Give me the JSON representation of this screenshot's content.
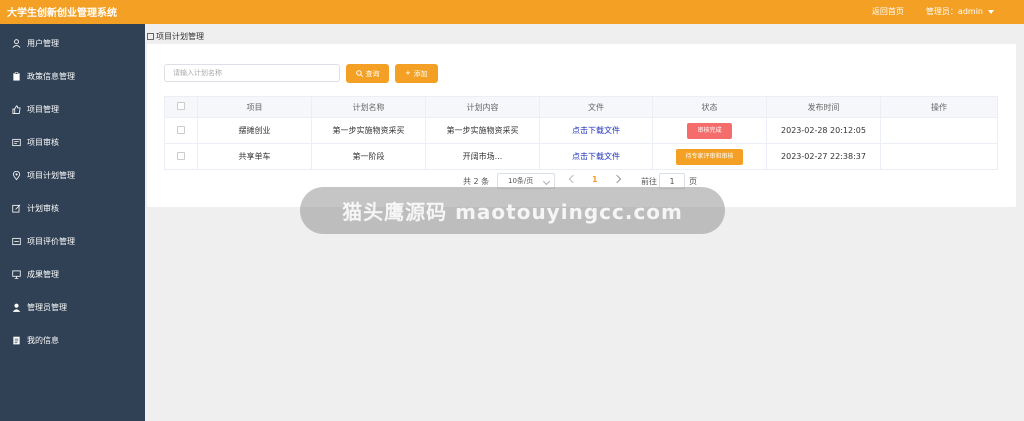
{
  "header": {
    "app_title": "大学生创新创业管理系统",
    "home_link": "返回首页",
    "admin_label": "管理员：admin"
  },
  "sidebar": {
    "items": [
      {
        "label": "用户管理",
        "icon": "user-icon"
      },
      {
        "label": "政策信息管理",
        "icon": "clipboard-icon"
      },
      {
        "label": "项目管理",
        "icon": "thumbs-up-icon"
      },
      {
        "label": "项目审核",
        "icon": "document-icon"
      },
      {
        "label": "项目计划管理",
        "icon": "location-icon"
      },
      {
        "label": "计划审核",
        "icon": "edit-icon"
      },
      {
        "label": "项目评价管理",
        "icon": "edit-box-icon"
      },
      {
        "label": "成果管理",
        "icon": "monitor-icon"
      },
      {
        "label": "管理员管理",
        "icon": "person-icon"
      },
      {
        "label": "我的信息",
        "icon": "file-icon"
      }
    ]
  },
  "breadcrumb": "项目计划管理",
  "search": {
    "placeholder": "请输入计划名称",
    "query_label": "查询",
    "add_label": "添加"
  },
  "table": {
    "headers": [
      "",
      "项目",
      "计划名称",
      "计划内容",
      "文件",
      "状态",
      "发布时间",
      "操作"
    ],
    "rows": [
      {
        "project": "摆摊创业",
        "plan_name": "第一步实施物资采买",
        "content": "第一步实施物资采买",
        "file": "点击下载文件",
        "status": "审核完成",
        "time": "2023-02-28 20:12:05"
      },
      {
        "project": "共享单车",
        "plan_name": "第一阶段",
        "content": "开阔市场...",
        "file": "点击下载文件",
        "status": "待专家评审和审核",
        "time": "2023-02-27 22:38:37"
      }
    ]
  },
  "pagination": {
    "total": "共 2 条",
    "page_size": "10条/页",
    "current": "1",
    "goto_label": "前往",
    "goto_value": "1",
    "goto_unit": "页"
  },
  "watermark": "猫头鹰源码 maotouyingcc.com",
  "colors": {
    "accent": "#f4a024",
    "sidebar": "#304155",
    "danger": "#f56c6c"
  }
}
